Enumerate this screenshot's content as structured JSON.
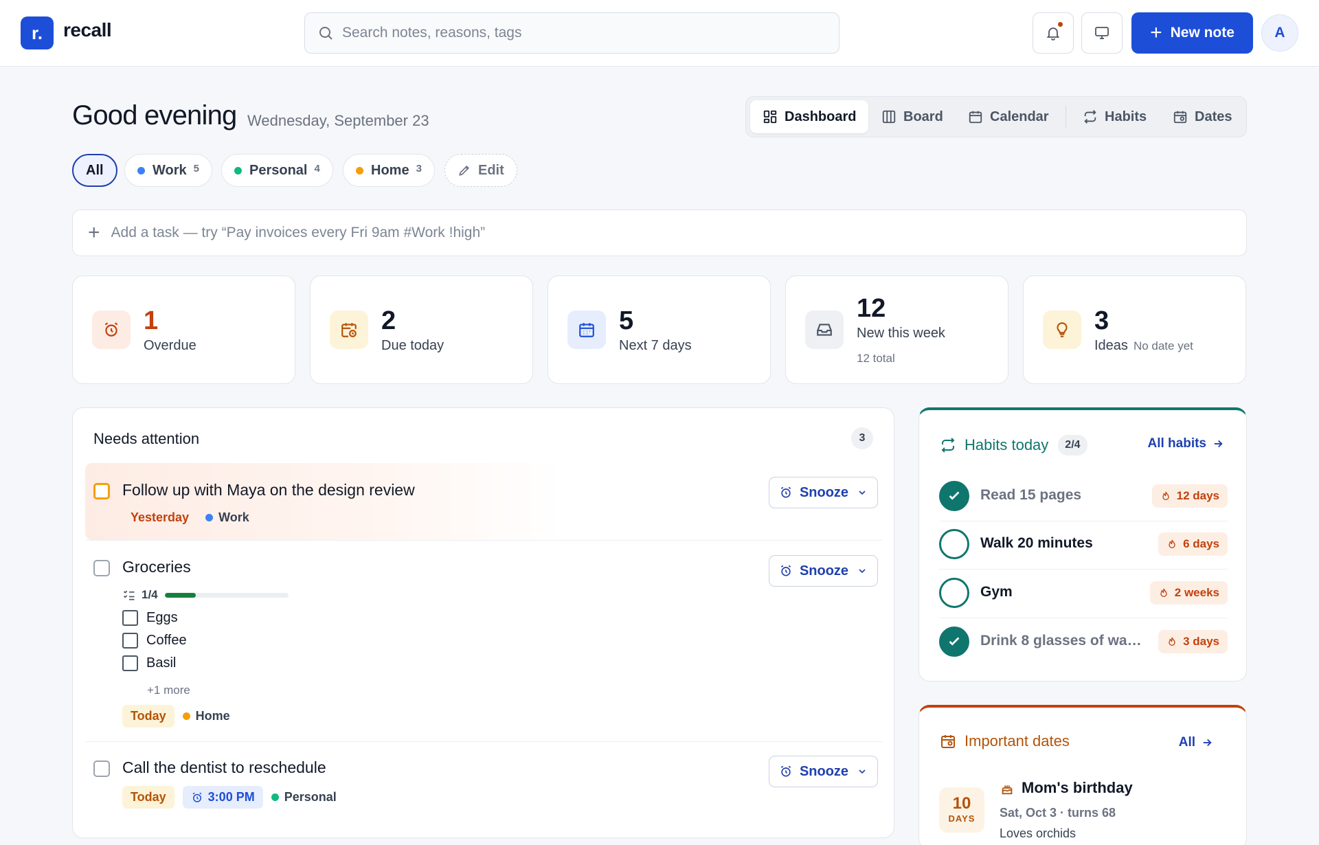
{
  "app": {
    "logo_mark": "r.",
    "name": "recall"
  },
  "search": {
    "placeholder": "Search notes, reasons, tags",
    "value": ""
  },
  "header": {
    "new_note_label": "New note",
    "avatar_initial": "A",
    "icons": [
      "bell-icon",
      "monitor-icon"
    ]
  },
  "greeting": {
    "title": "Good evening",
    "date": "Wednesday, September 23"
  },
  "view_tabs": [
    {
      "label": "Dashboard",
      "icon": "dashboard-icon",
      "active": true
    },
    {
      "label": "Board",
      "icon": "board-icon"
    },
    {
      "label": "Calendar",
      "icon": "calendar-icon"
    },
    {
      "label": "Habits",
      "icon": "repeat-icon"
    },
    {
      "label": "Dates",
      "icon": "calendar-heart-icon"
    }
  ],
  "filters": [
    {
      "label": "All",
      "active": true
    },
    {
      "label": "Work",
      "count": "5",
      "color": "#3b82f6"
    },
    {
      "label": "Personal",
      "count": "4",
      "color": "#10b981"
    },
    {
      "label": "Home",
      "count": "3",
      "color": "#f59e0b"
    },
    {
      "label": "Edit",
      "icon": "pencil-icon"
    }
  ],
  "add_task": {
    "placeholder": "Add a task — try “Pay invoices every Fri 9am #Work !high”"
  },
  "stats": [
    {
      "value": "1",
      "label": "Overdue",
      "color": "#c2410c"
    },
    {
      "value": "2",
      "label": "Due today"
    },
    {
      "value": "5",
      "label": "Next 7 days"
    },
    {
      "value": "12",
      "label": "New this week",
      "sub": "12 total"
    },
    {
      "value": "3",
      "label": "Ideas",
      "sub": "No date yet"
    }
  ],
  "needs_attention": {
    "title": "Needs attention",
    "count": "3",
    "snooze_label": "Snooze",
    "tasks": [
      {
        "title": "Follow up with Maya on the design review",
        "due": "Yesterday",
        "tag": "Work",
        "tag_color": "#3b82f6"
      },
      {
        "title": "Groceries",
        "progress_label": "1/4",
        "progress": 0.25,
        "subtasks": [
          "Eggs",
          "Coffee",
          "Basil"
        ],
        "more": "+1 more",
        "due": "Today",
        "tag": "Home",
        "tag_color": "#f59e0b"
      },
      {
        "title": "Call the dentist to reschedule",
        "due": "Today",
        "time": "3:00 PM",
        "tag": "Personal",
        "tag_color": "#10b981"
      }
    ]
  },
  "habits": {
    "title": "Habits today",
    "badge": "2/4",
    "link": "All habits",
    "items": [
      {
        "name": "Read 15 pages",
        "streak": "12 days",
        "done": true
      },
      {
        "name": "Walk 20 minutes",
        "streak": "6 days",
        "done": false
      },
      {
        "name": "Gym",
        "streak": "2 weeks",
        "done": false
      },
      {
        "name": "Drink 8 glasses of wa…",
        "streak": "3 days",
        "done": true
      }
    ]
  },
  "important_dates": {
    "title": "Important dates",
    "link": "All",
    "event": {
      "days_num": "10",
      "days_label": "DAYS",
      "title": "Mom's birthday",
      "sub": "Sat, Oct 3 · turns 68",
      "note": "Loves orchids"
    }
  }
}
